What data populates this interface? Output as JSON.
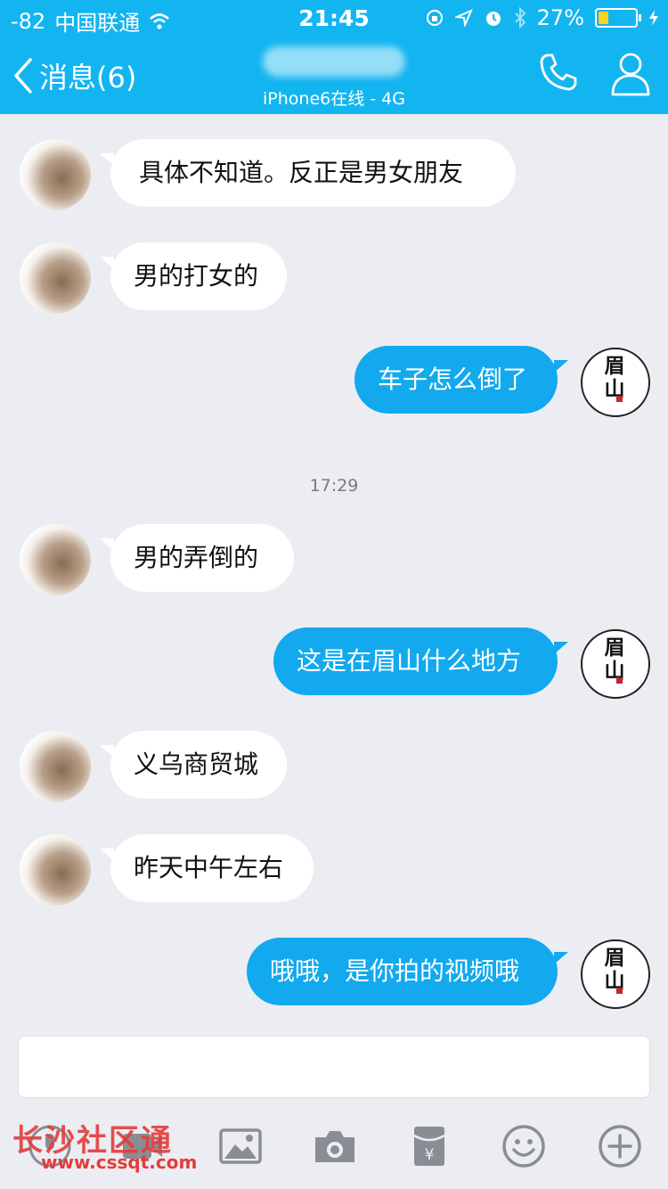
{
  "status_bar": {
    "signal": "-82",
    "carrier": "中国联通",
    "time": "21:45",
    "battery_percent": "27%",
    "battery_level": 0.27
  },
  "nav": {
    "back_label": "消息(6)",
    "subtitle": "iPhone6在线 - 4G",
    "call_icon": "phone-icon",
    "profile_icon": "person-icon"
  },
  "messages": [
    {
      "side": "in",
      "text": "具体不知道。反正是男女朋友"
    },
    {
      "side": "in",
      "text": "男的打女的"
    },
    {
      "side": "out",
      "text": "车子怎么倒了"
    },
    {
      "side": "in",
      "text": "男的弄倒的"
    },
    {
      "side": "out",
      "text": "这是在眉山什么地方"
    },
    {
      "side": "in",
      "text": "义乌商贸城"
    },
    {
      "side": "in",
      "text": "昨天中午左右"
    },
    {
      "side": "out",
      "text": "哦哦，是你拍的视频哦"
    }
  ],
  "timestamp": "17:29",
  "my_avatar_text": "眉山",
  "toolbar": [
    "microphone-icon",
    "video-icon",
    "image-icon",
    "camera-icon",
    "red-packet-icon",
    "emoji-icon",
    "plus-icon"
  ],
  "watermark": {
    "text": "长沙社区通",
    "url": "www.cssqt.com"
  },
  "colors": {
    "accent": "#13b5f0",
    "outgoing_bubble": "#13a9ee",
    "chat_background": "#ebedf2"
  }
}
